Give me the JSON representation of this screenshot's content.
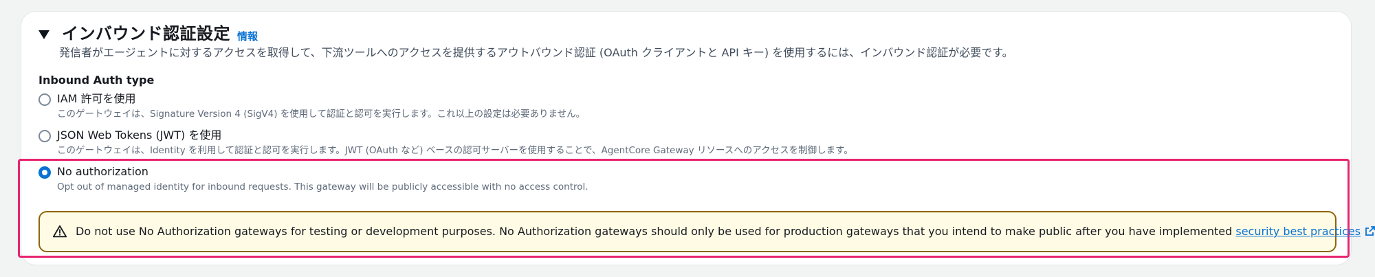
{
  "section": {
    "title": "インバウンド認証設定",
    "info_link": "情報",
    "description": "発信者がエージェントに対するアクセスを取得して、下流ツールへのアクセスを提供するアウトバウンド認証 (OAuth クライアントと API キー) を使用するには、インバウンド認証が必要です。"
  },
  "inbound_auth": {
    "label": "Inbound Auth type",
    "options": [
      {
        "label": "IAM 許可を使用",
        "description": "このゲートウェイは、Signature Version 4 (SigV4) を使用して認証と認可を実行します。これ以上の設定は必要ありません。",
        "selected": false
      },
      {
        "label": "JSON Web Tokens (JWT) を使用",
        "description": "このゲートウェイは、Identity を利用して認証と認可を実行します。JWT (OAuth など) ベースの認可サーバーを使用することで、AgentCore Gateway リソースへのアクセスを制御します。",
        "selected": false
      },
      {
        "label": "No authorization",
        "description": "Opt out of managed identity for inbound requests. This gateway will be publicly accessible with no access control.",
        "selected": true
      }
    ]
  },
  "alert": {
    "text": "Do not use No Authorization gateways for testing or development purposes. No Authorization gateways should only be used for production gateways that you intend to make public after you have implemented ",
    "link_text": "security best practices",
    "trailing": "."
  },
  "colors": {
    "accent": "#0972d3",
    "highlight": "#e8246f",
    "warning_border": "#8d6605",
    "warning_bg": "#fffbe5"
  },
  "icons": {
    "caret": "caret-down-icon",
    "warning": "warning-icon",
    "external": "external-link-icon"
  }
}
